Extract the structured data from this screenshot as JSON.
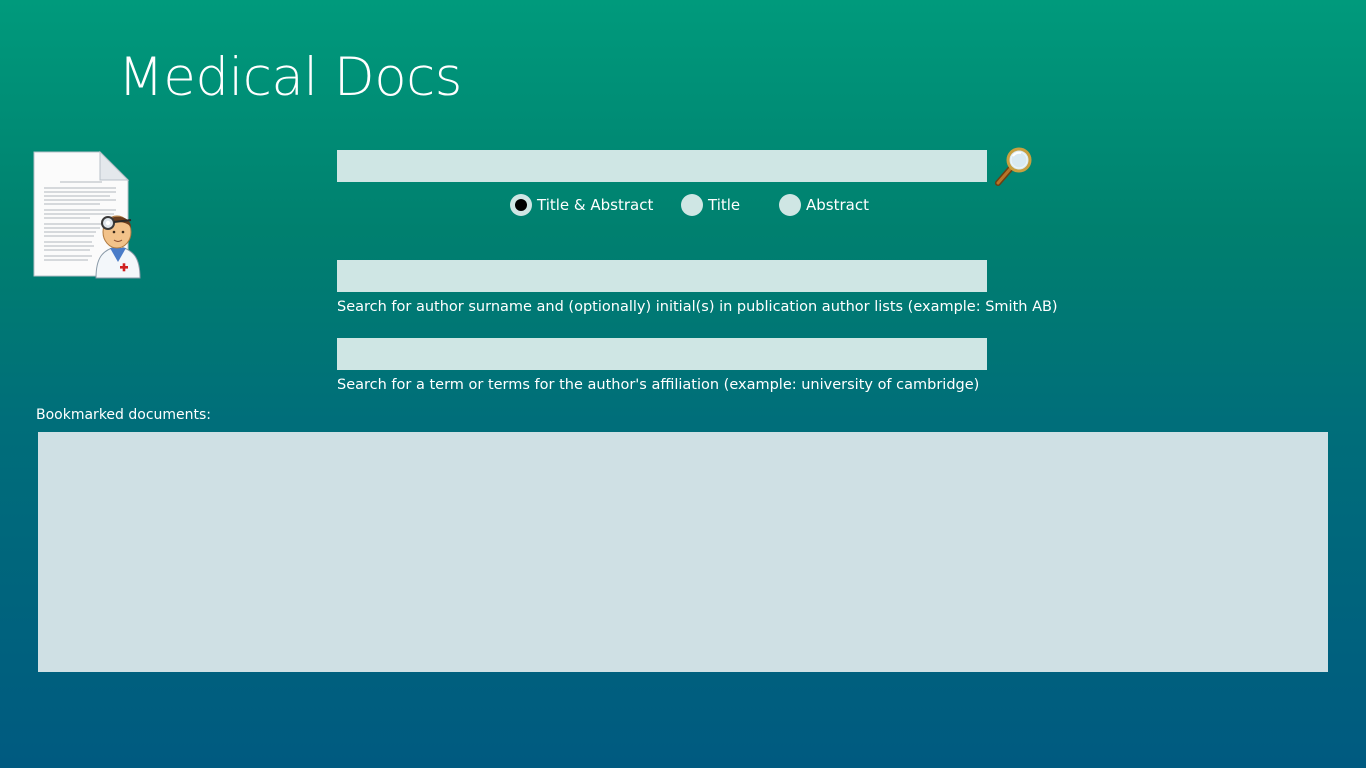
{
  "app": {
    "title": "Medical Docs"
  },
  "search": {
    "query_value": "",
    "scope_options": [
      {
        "label": "Title & Abstract",
        "checked": true
      },
      {
        "label": "Title",
        "checked": false
      },
      {
        "label": "Abstract",
        "checked": false
      }
    ],
    "button_icon": "magnifier-icon"
  },
  "author": {
    "value": "",
    "hint": "Search for author surname and (optionally) initial(s) in publication author lists (example: Smith AB)"
  },
  "affiliation": {
    "value": "",
    "hint": "Search for a term or terms for the author's affiliation (example: university of cambridge)"
  },
  "bookmarks": {
    "label": "Bookmarked documents:",
    "items": []
  },
  "icons": {
    "logo": "document-doctor-logo-icon"
  },
  "colors": {
    "background_top": "#009a7c",
    "background_bottom": "#005a80",
    "input_fill": "#cfe6e4",
    "list_fill": "#cfe0e4"
  }
}
